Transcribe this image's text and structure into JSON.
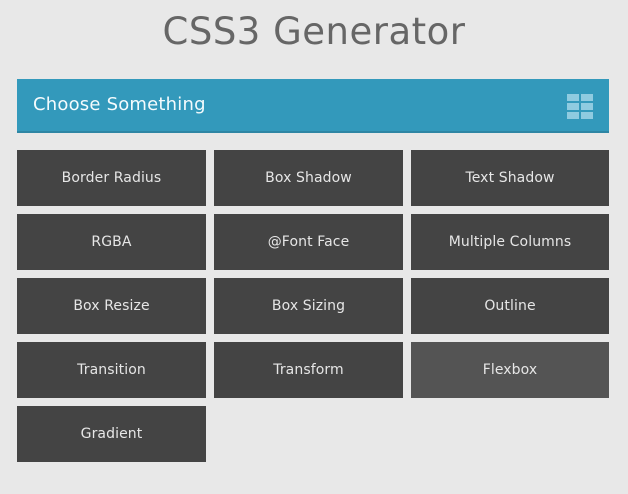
{
  "title": "CSS3 Generator",
  "selector": {
    "label": "Choose Something",
    "icon": "grid-icon",
    "accent_color": "#3399bb"
  },
  "options": [
    {
      "label": "Border Radius"
    },
    {
      "label": "Box Shadow"
    },
    {
      "label": "Text Shadow"
    },
    {
      "label": "RGBA"
    },
    {
      "label": "@Font Face"
    },
    {
      "label": "Multiple Columns"
    },
    {
      "label": "Box Resize"
    },
    {
      "label": "Box Sizing"
    },
    {
      "label": "Outline"
    },
    {
      "label": "Transition"
    },
    {
      "label": "Transform"
    },
    {
      "label": "Flexbox",
      "highlighted": true
    },
    {
      "label": "Gradient"
    }
  ],
  "colors": {
    "background": "#e8e8e8",
    "tile": "#444444",
    "tile_highlighted": "#545454",
    "title_text": "#666666"
  }
}
